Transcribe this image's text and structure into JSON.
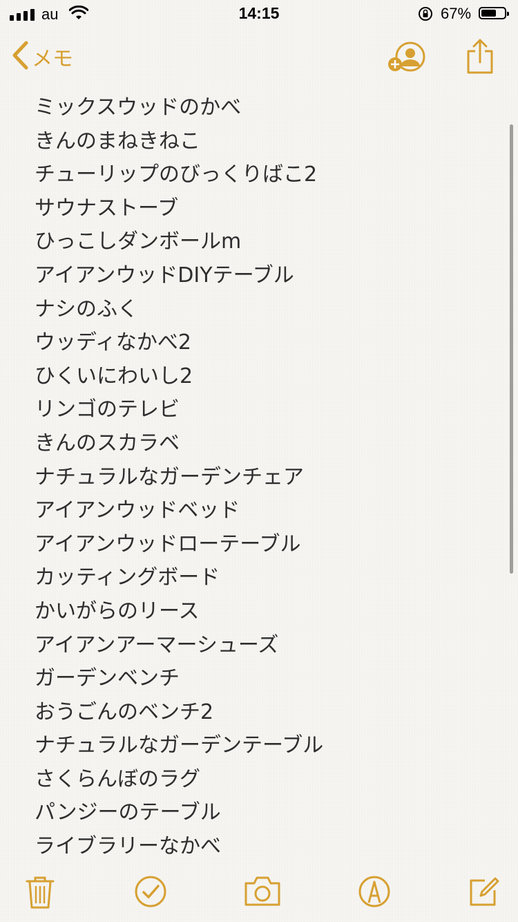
{
  "status_bar": {
    "carrier": "au",
    "time": "14:15",
    "battery_percent": "67%",
    "battery_level": 0.67
  },
  "nav": {
    "back_label": "メモ"
  },
  "note": {
    "lines": [
      "ミックスウッドのかべ",
      "きんのまねきねこ",
      "チューリップのびっくりばこ2",
      "サウナストーブ",
      "ひっこしダンボールm",
      "アイアンウッドDIYテーブル",
      "ナシのふく",
      "ウッディなかべ2",
      "ひくいにわいし2",
      "リンゴのテレビ",
      "きんのスカラベ",
      "ナチュラルなガーデンチェア",
      "アイアンウッドベッド",
      "アイアンウッドローテーブル",
      "カッティングボード",
      "かいがらのリース",
      "アイアンアーマーシューズ",
      "ガーデンベンチ",
      "おうごんのベンチ2",
      "ナチュラルなガーデンテーブル",
      "さくらんぼのラグ",
      "パンジーのテーブル",
      "ライブラリーなかべ"
    ]
  },
  "colors": {
    "accent": "#d7a032",
    "text": "#2e2e2e",
    "background": "#f6f5f2"
  },
  "icons": {
    "back": "chevron-left-icon",
    "add_person": "add-person-icon",
    "share": "share-icon",
    "trash": "trash-icon",
    "checklist": "checkmark-circle-icon",
    "camera": "camera-icon",
    "markup": "pen-tip-icon",
    "compose": "compose-icon"
  }
}
